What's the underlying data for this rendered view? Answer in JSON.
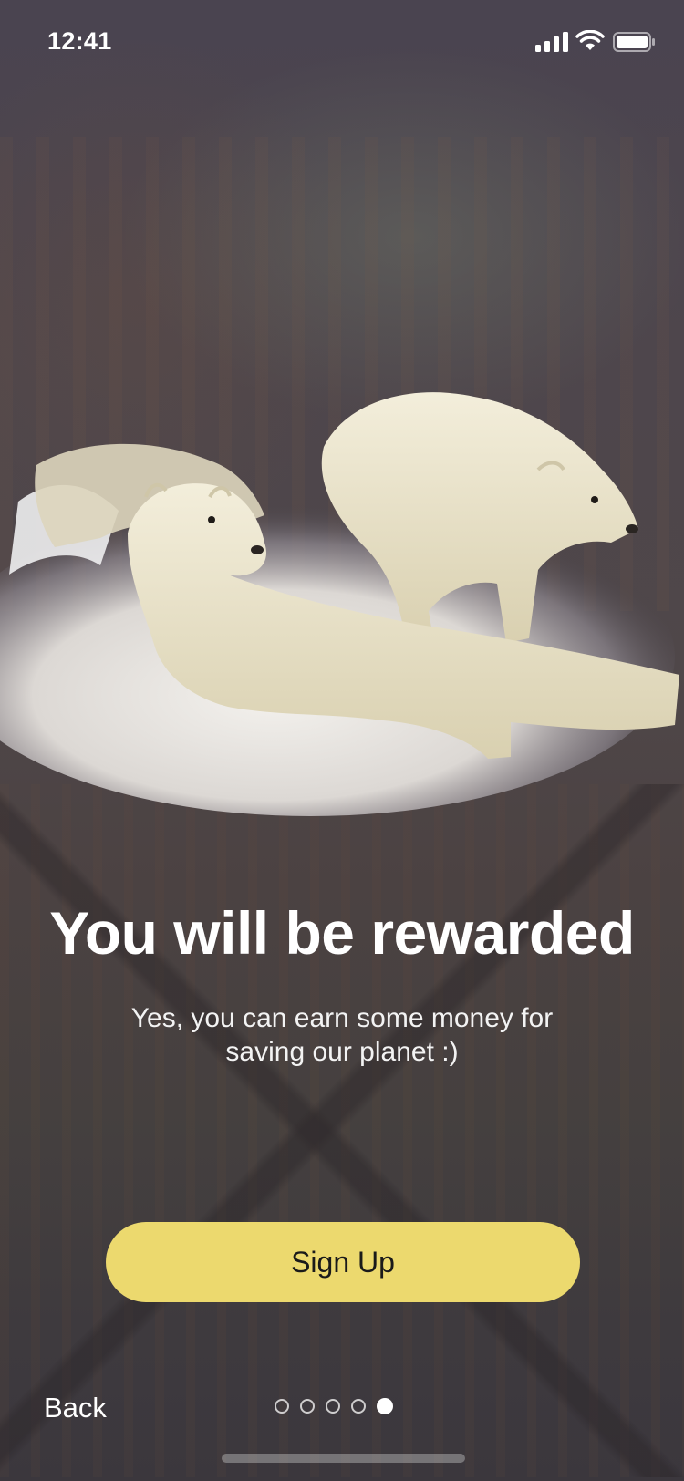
{
  "status_bar": {
    "time": "12:41"
  },
  "onboarding": {
    "headline": "You will be rewarded",
    "subtitle_line1": "Yes, you can earn some money for",
    "subtitle_line2": "saving our planet :)",
    "primary_button": "Sign Up",
    "back_label": "Back",
    "page_indicator": {
      "total": 5,
      "current": 5
    }
  },
  "colors": {
    "accent_button": "#ecd96e",
    "background": "#474148"
  },
  "icons": [
    "signal-icon",
    "wifi-icon",
    "battery-icon"
  ]
}
